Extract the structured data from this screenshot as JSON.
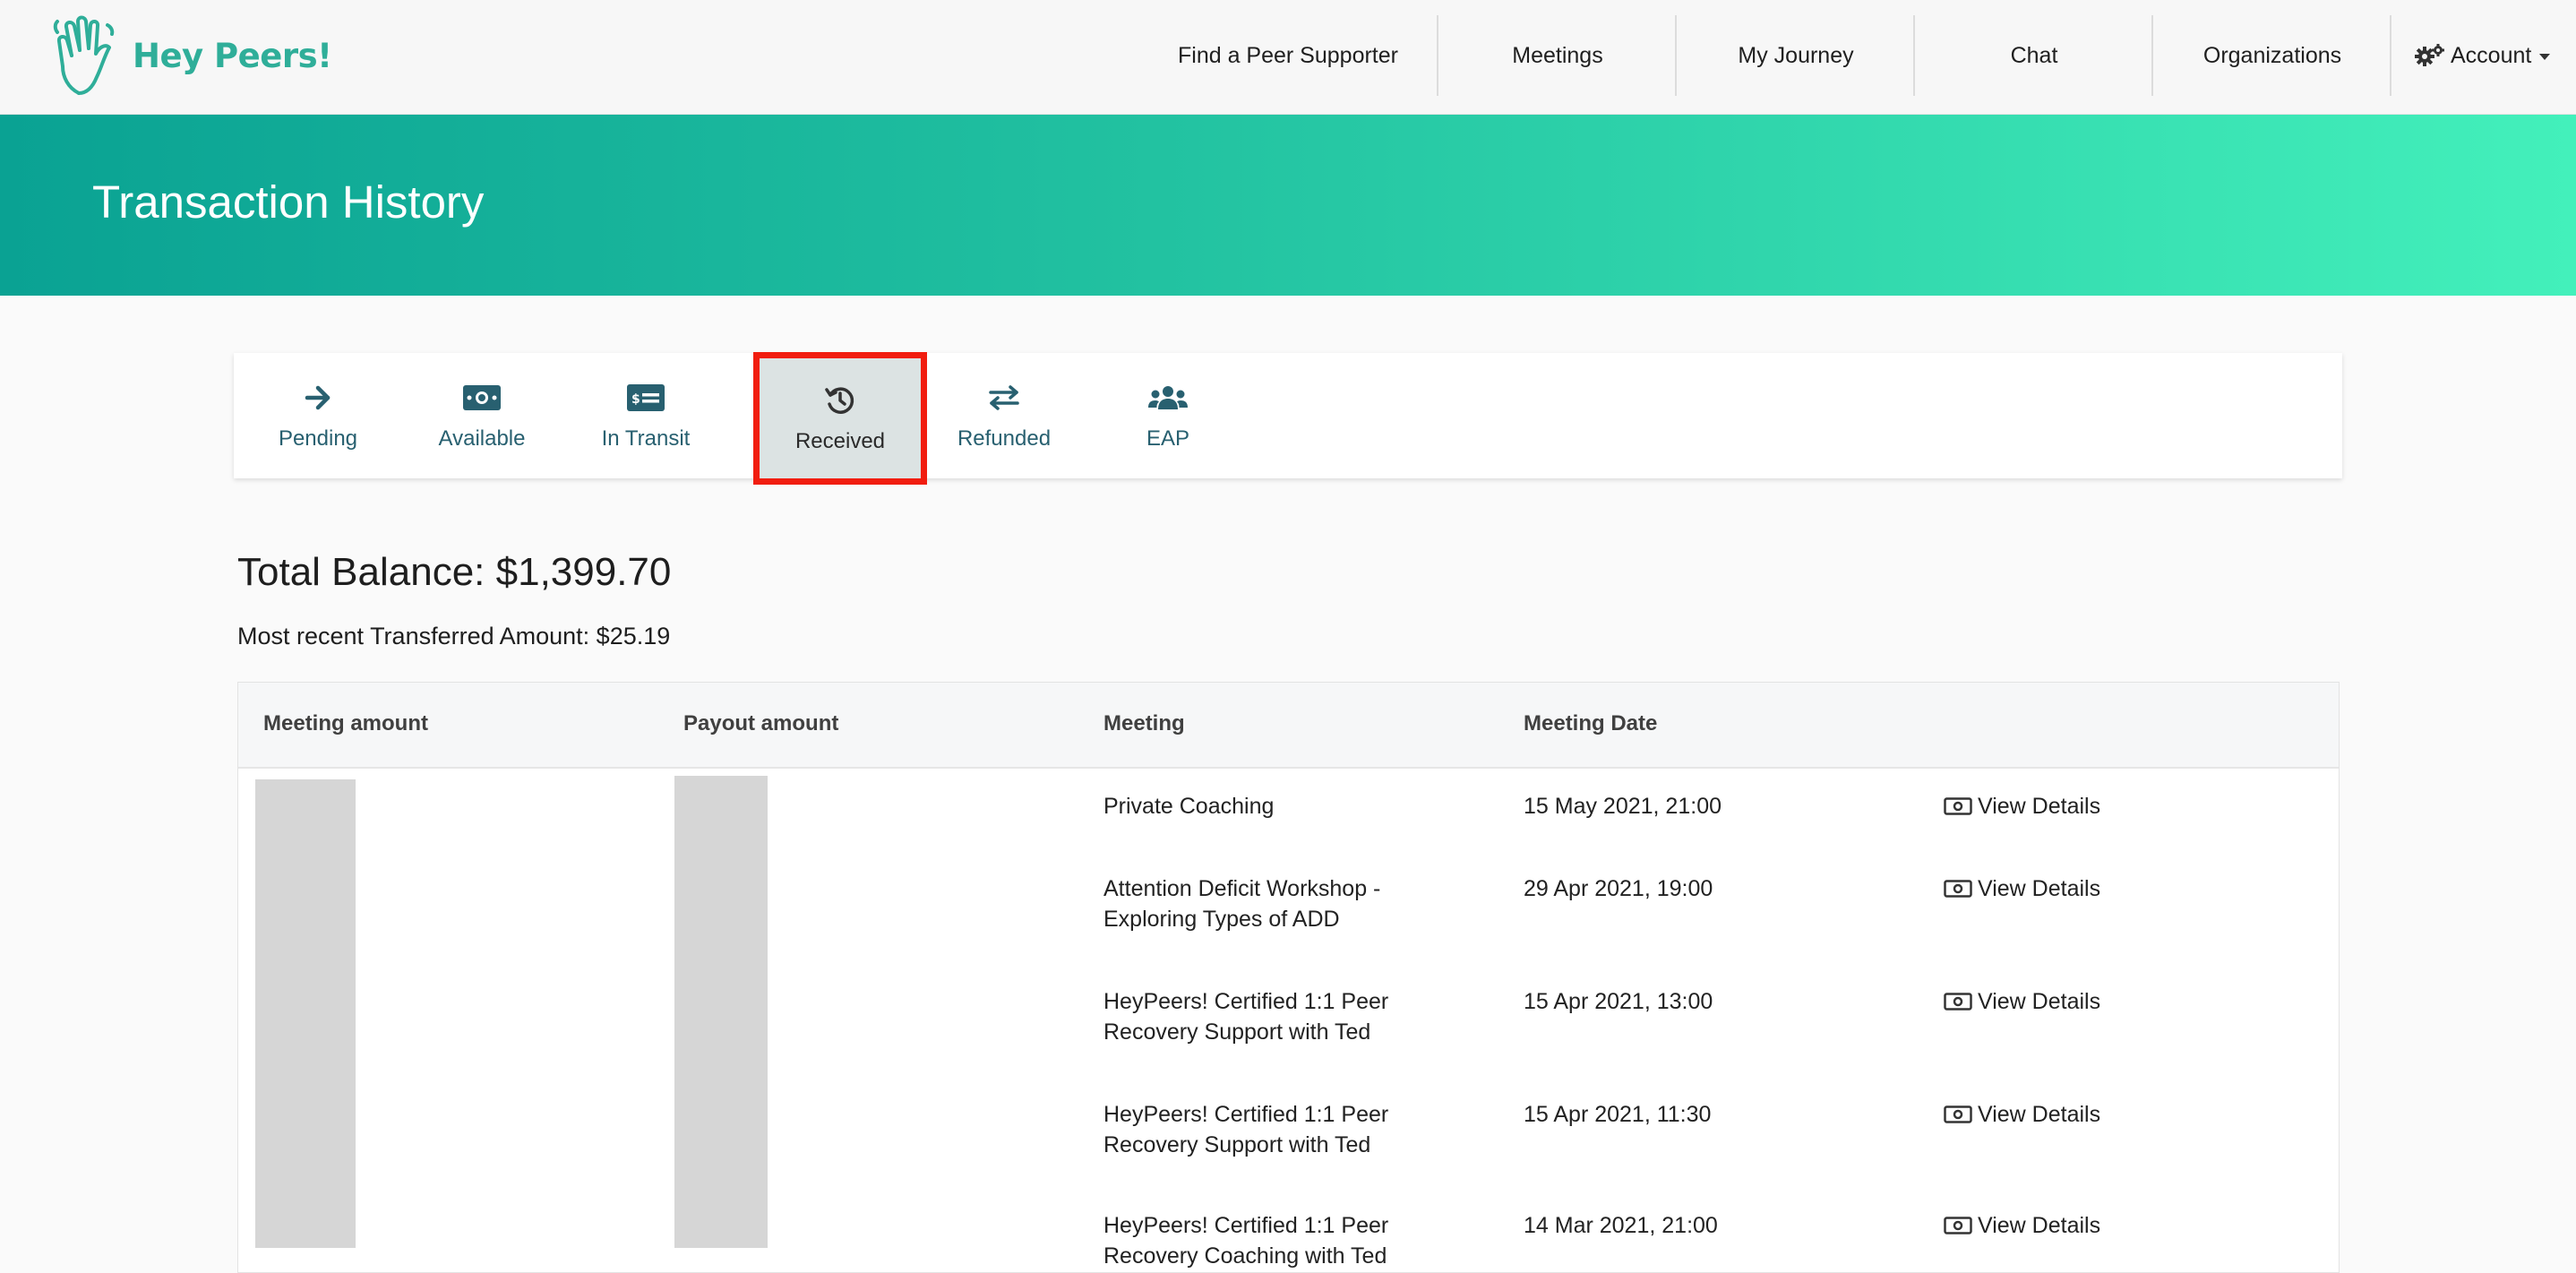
{
  "nav": {
    "brand": "Hey Peers!",
    "items": [
      "Find a Peer Supporter",
      "Meetings",
      "My Journey",
      "Chat",
      "Organizations"
    ],
    "account": "Account"
  },
  "banner": {
    "title": "Transaction History"
  },
  "tabs": [
    {
      "label": "Pending",
      "icon": "arrow-right-icon"
    },
    {
      "label": "Available",
      "icon": "money-bill-icon"
    },
    {
      "label": "In Transit",
      "icon": "money-check-icon"
    },
    {
      "label": "Received",
      "icon": "history-icon",
      "active": true
    },
    {
      "label": "Refunded",
      "icon": "exchange-icon"
    },
    {
      "label": "EAP",
      "icon": "users-icon"
    }
  ],
  "balance": {
    "total": "Total Balance: $1,399.70",
    "recent": "Most recent Transferred Amount: $25.19"
  },
  "table": {
    "headers": [
      "Meeting amount",
      "Payout amount",
      "Meeting",
      "Meeting Date"
    ],
    "rows": [
      {
        "meeting": [
          "Private Coaching"
        ],
        "date": "15 May 2021, 21:00",
        "action": "View Details"
      },
      {
        "meeting": [
          "Attention Deficit Workshop -",
          "Exploring Types of ADD"
        ],
        "date": "29 Apr 2021, 19:00",
        "action": "View Details"
      },
      {
        "meeting": [
          "HeyPeers! Certified 1:1 Peer",
          "Recovery Support with Ted"
        ],
        "date": "15 Apr 2021, 13:00",
        "action": "View Details"
      },
      {
        "meeting": [
          "HeyPeers! Certified 1:1 Peer",
          "Recovery Support with Ted"
        ],
        "date": "15 Apr 2021, 11:30",
        "action": "View Details"
      },
      {
        "meeting": [
          "HeyPeers! Certified 1:1 Peer",
          "Recovery Coaching with Ted"
        ],
        "date": "14 Mar 2021, 21:00",
        "action": "View Details"
      }
    ]
  },
  "colors": {
    "brand": "#2fae99",
    "tab_text": "#286070",
    "highlight_border": "#f11d0f",
    "banner_start": "#0aa293",
    "banner_end": "#43f0bb"
  }
}
